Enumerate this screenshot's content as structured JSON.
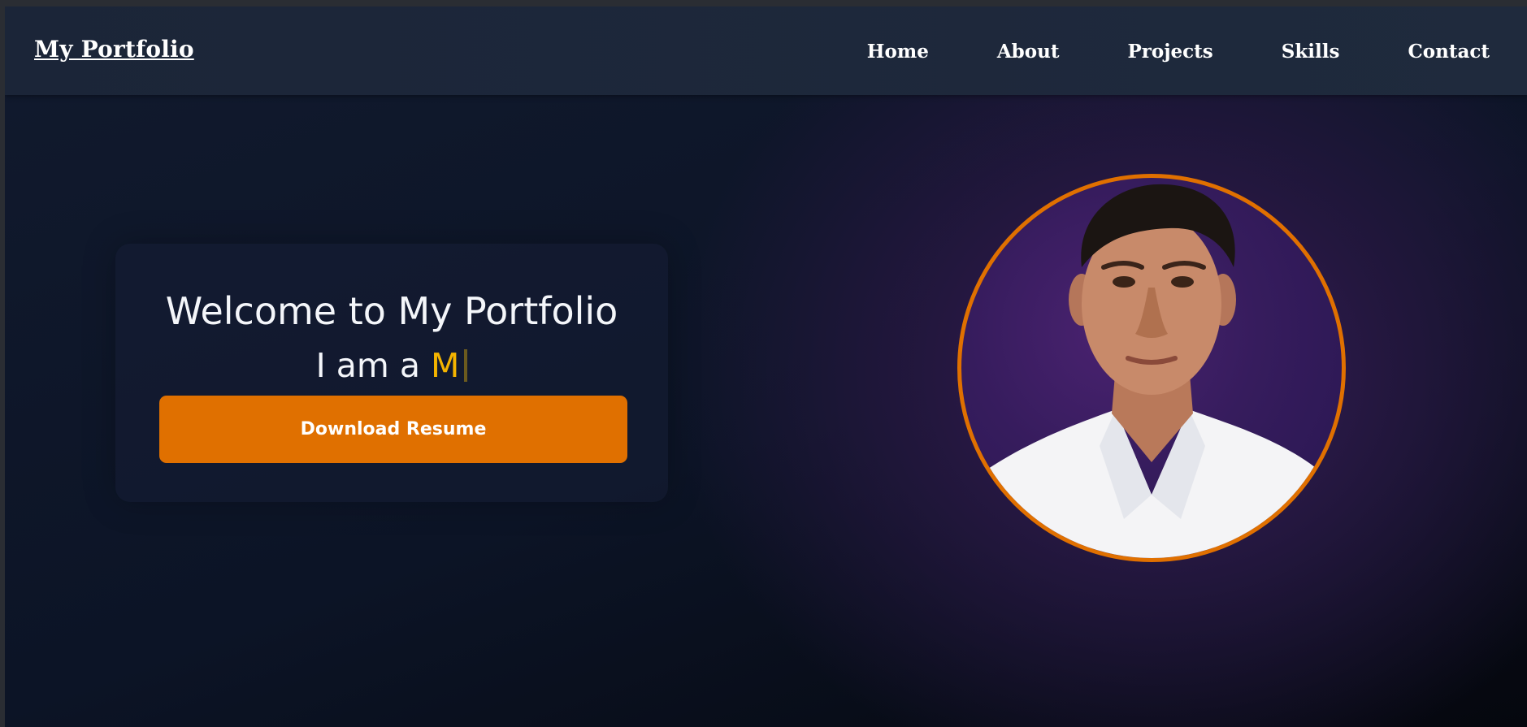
{
  "navbar": {
    "brand": "My Portfolio",
    "links": [
      "Home",
      "About",
      "Projects",
      "Skills",
      "Contact"
    ]
  },
  "hero": {
    "title": "Welcome to My Portfolio",
    "typing_prefix": "I am a ",
    "typing_text": "M",
    "download_label": "Download Resume"
  },
  "colors": {
    "accent": "#e07000",
    "typed_text": "#f4b400",
    "navbar_bg": "#1f2a3d",
    "page_bg": "#0c1426",
    "glow": "#3a1c5e"
  },
  "icons": {
    "profile_photo": "profile-photo"
  }
}
